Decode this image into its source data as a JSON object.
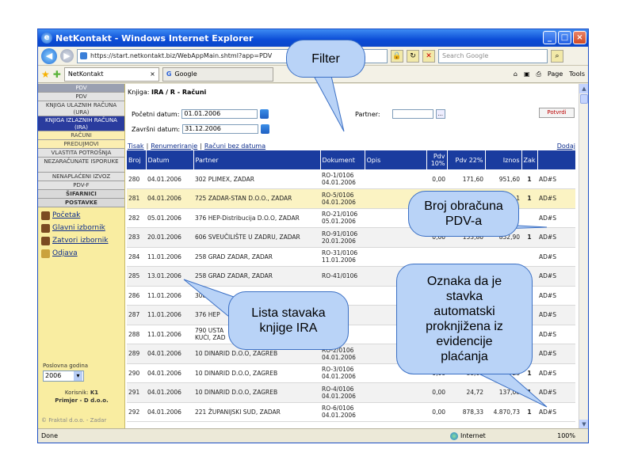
{
  "window": {
    "title": "NetKontakt - Windows Internet Explorer"
  },
  "browser": {
    "url": "https://start.netkontakt.biz/WebAppMain.shtml?app=PDV",
    "search_placeholder": "Search Google",
    "tabs": [
      "NetKontakt",
      "Google"
    ],
    "page_menu": "Page",
    "tools_menu": "Tools"
  },
  "sidebar": {
    "header": "PDV",
    "items": [
      "PDV",
      "KNJIGA ULAZNIH RAČUNA (URA)",
      "KNJIGA IZLAZNIH RAČUNA (IRA)",
      "RAČUNI",
      "PREDUJMOVI",
      "VLASTITA POTROŠNJA",
      "NEZARAČUNATE ISPORUKE",
      "NENAPLAĆENI IZVOZ",
      "PDV-F",
      "ŠIFARNICI",
      "POSTAVKE"
    ],
    "links": [
      "Početak",
      "Glavni izbornik",
      "Zatvori izbornik",
      "Odjava"
    ],
    "year_label": "Poslovna godina",
    "year_value": "2006",
    "user_label": "Korisnik:",
    "user_value": "K1",
    "company": "Primjer - D d.o.o.",
    "footer": "© Fraktal d.o.o. - Zadar"
  },
  "filter": {
    "book_label": "Knjiga:",
    "book_value": "IRA / R - Računi",
    "start_label": "Početni datum:",
    "start_value": "01.01.2006",
    "end_label": "Završni datum:",
    "end_value": "31.12.2006",
    "partner_label": "Partner:",
    "partner_dots": "...",
    "confirm": "Potvrdi"
  },
  "actions": {
    "print": "Tisak",
    "renumber": "Renumeriranje",
    "no_date": "Računi bez datuma",
    "add": "Dodaj"
  },
  "table": {
    "headers": [
      "Broj",
      "Datum",
      "Partner",
      "Dokument",
      "Opis",
      "Pdv 10%",
      "Pdv 22%",
      "Iznos",
      "Zak",
      ""
    ],
    "rows": [
      {
        "broj": "280",
        "datum": "04.01.2006",
        "partner": "302 PLIMEX, ZADAR",
        "dok1": "RO-1/0106",
        "dok2": "04.01.2006",
        "pdv10": "0,00",
        "pdv22": "171,60",
        "iznos": "951,60",
        "zak": "1",
        "oznaka": "AD#S"
      },
      {
        "broj": "281",
        "datum": "04.01.2006",
        "partner": "725 ZADAR-STAN D.O.O., ZADAR",
        "dok1": "RO-5/0106",
        "dok2": "04.01.2006",
        "pdv10": "",
        "pdv22": "",
        "iznos": "1",
        "zak": "1",
        "oznaka": "AD#S"
      },
      {
        "broj": "282",
        "datum": "05.01.2006",
        "partner": "376 HEP-Distribucija D.O.O, ZADAR",
        "dok1": "RO-21/0106",
        "dok2": "05.01.2006",
        "pdv10": "",
        "pdv22": "",
        "iznos": "",
        "zak": "",
        "oznaka": "AD#S"
      },
      {
        "broj": "283",
        "datum": "20.01.2006",
        "partner": "606 SVEUČILIŠTE U ZADRU, ZADAR",
        "dok1": "RO-91/0106",
        "dok2": "20.01.2006",
        "pdv10": "0,00",
        "pdv22": "153,80",
        "iznos": "852,90",
        "zak": "1",
        "oznaka": "AD#S"
      },
      {
        "broj": "284",
        "datum": "11.01.2006",
        "partner": "258 GRAD ZADAR, ZADAR",
        "dok1": "RO-31/0106",
        "dok2": "11.01.2006",
        "pdv10": "",
        "pdv22": "",
        "iznos": "",
        "zak": "",
        "oznaka": "AD#S"
      },
      {
        "broj": "285",
        "datum": "13.01.2006",
        "partner": "258 GRAD ZADAR, ZADAR",
        "dok1": "RO-41/0106",
        "dok2": "",
        "pdv10": "",
        "pdv22": "",
        "iznos": "",
        "zak": "",
        "oznaka": "AD#S"
      },
      {
        "broj": "286",
        "datum": "11.01.2006",
        "partner": "308",
        "dok1": "",
        "dok2": "",
        "pdv10": "",
        "pdv22": "",
        "iznos": "",
        "zak": "",
        "oznaka": "AD#S"
      },
      {
        "broj": "287",
        "datum": "11.01.2006",
        "partner": "376 HEP",
        "dok1": "",
        "dok2": "",
        "pdv10": "",
        "pdv22": "",
        "iznos": "",
        "zak": "",
        "oznaka": "AD#S"
      },
      {
        "broj": "288",
        "datum": "11.01.2006",
        "partner": "790 USTA",
        "partner2": "KUĆI, ZAD",
        "dok1": "",
        "dok2": "",
        "pdv10": "",
        "pdv22": "",
        "iznos": "",
        "zak": "",
        "oznaka": "AD#S"
      },
      {
        "broj": "289",
        "datum": "04.01.2006",
        "partner": "10 DINARID D.O.O, ZAGREB",
        "dok1": "RO-2/0106",
        "dok2": "04.01.2006",
        "pdv10": "",
        "pdv22": "",
        "iznos": "",
        "zak": "",
        "oznaka": "AD#S"
      },
      {
        "broj": "290",
        "datum": "04.01.2006",
        "partner": "10 DINARID D.O.O, ZAGREB",
        "dok1": "RO-3/0106",
        "dok2": "04.01.2006",
        "pdv10": "0,00",
        "pdv22": "88,04",
        "iznos": "23",
        "zak": "1",
        "oznaka": "AD#S"
      },
      {
        "broj": "291",
        "datum": "04.01.2006",
        "partner": "10 DINARID D.O.O, ZAGREB",
        "dok1": "RO-4/0106",
        "dok2": "04.01.2006",
        "pdv10": "0,00",
        "pdv22": "24,72",
        "iznos": "137,08",
        "zak": "1",
        "oznaka": "AD#S"
      },
      {
        "broj": "292",
        "datum": "04.01.2006",
        "partner": "221 ŽUPANIJSKI SUD, ZADAR",
        "dok1": "RO-6/0106",
        "dok2": "04.01.2006",
        "pdv10": "0,00",
        "pdv22": "878,33",
        "iznos": "4.870,73",
        "zak": "1",
        "oznaka": "AD#S"
      }
    ]
  },
  "statusbar": {
    "status": "Done",
    "zone": "Internet",
    "zoom": "100%"
  },
  "callouts": {
    "filter": "Filter",
    "pdv": "Broj obračuna\nPDV-a",
    "list": "Lista stavaka\nknjige IRA",
    "auto": "Oznaka da je\nstavka\nautomatski\nproknjižena iz\nevidencije\nplaćanja"
  }
}
